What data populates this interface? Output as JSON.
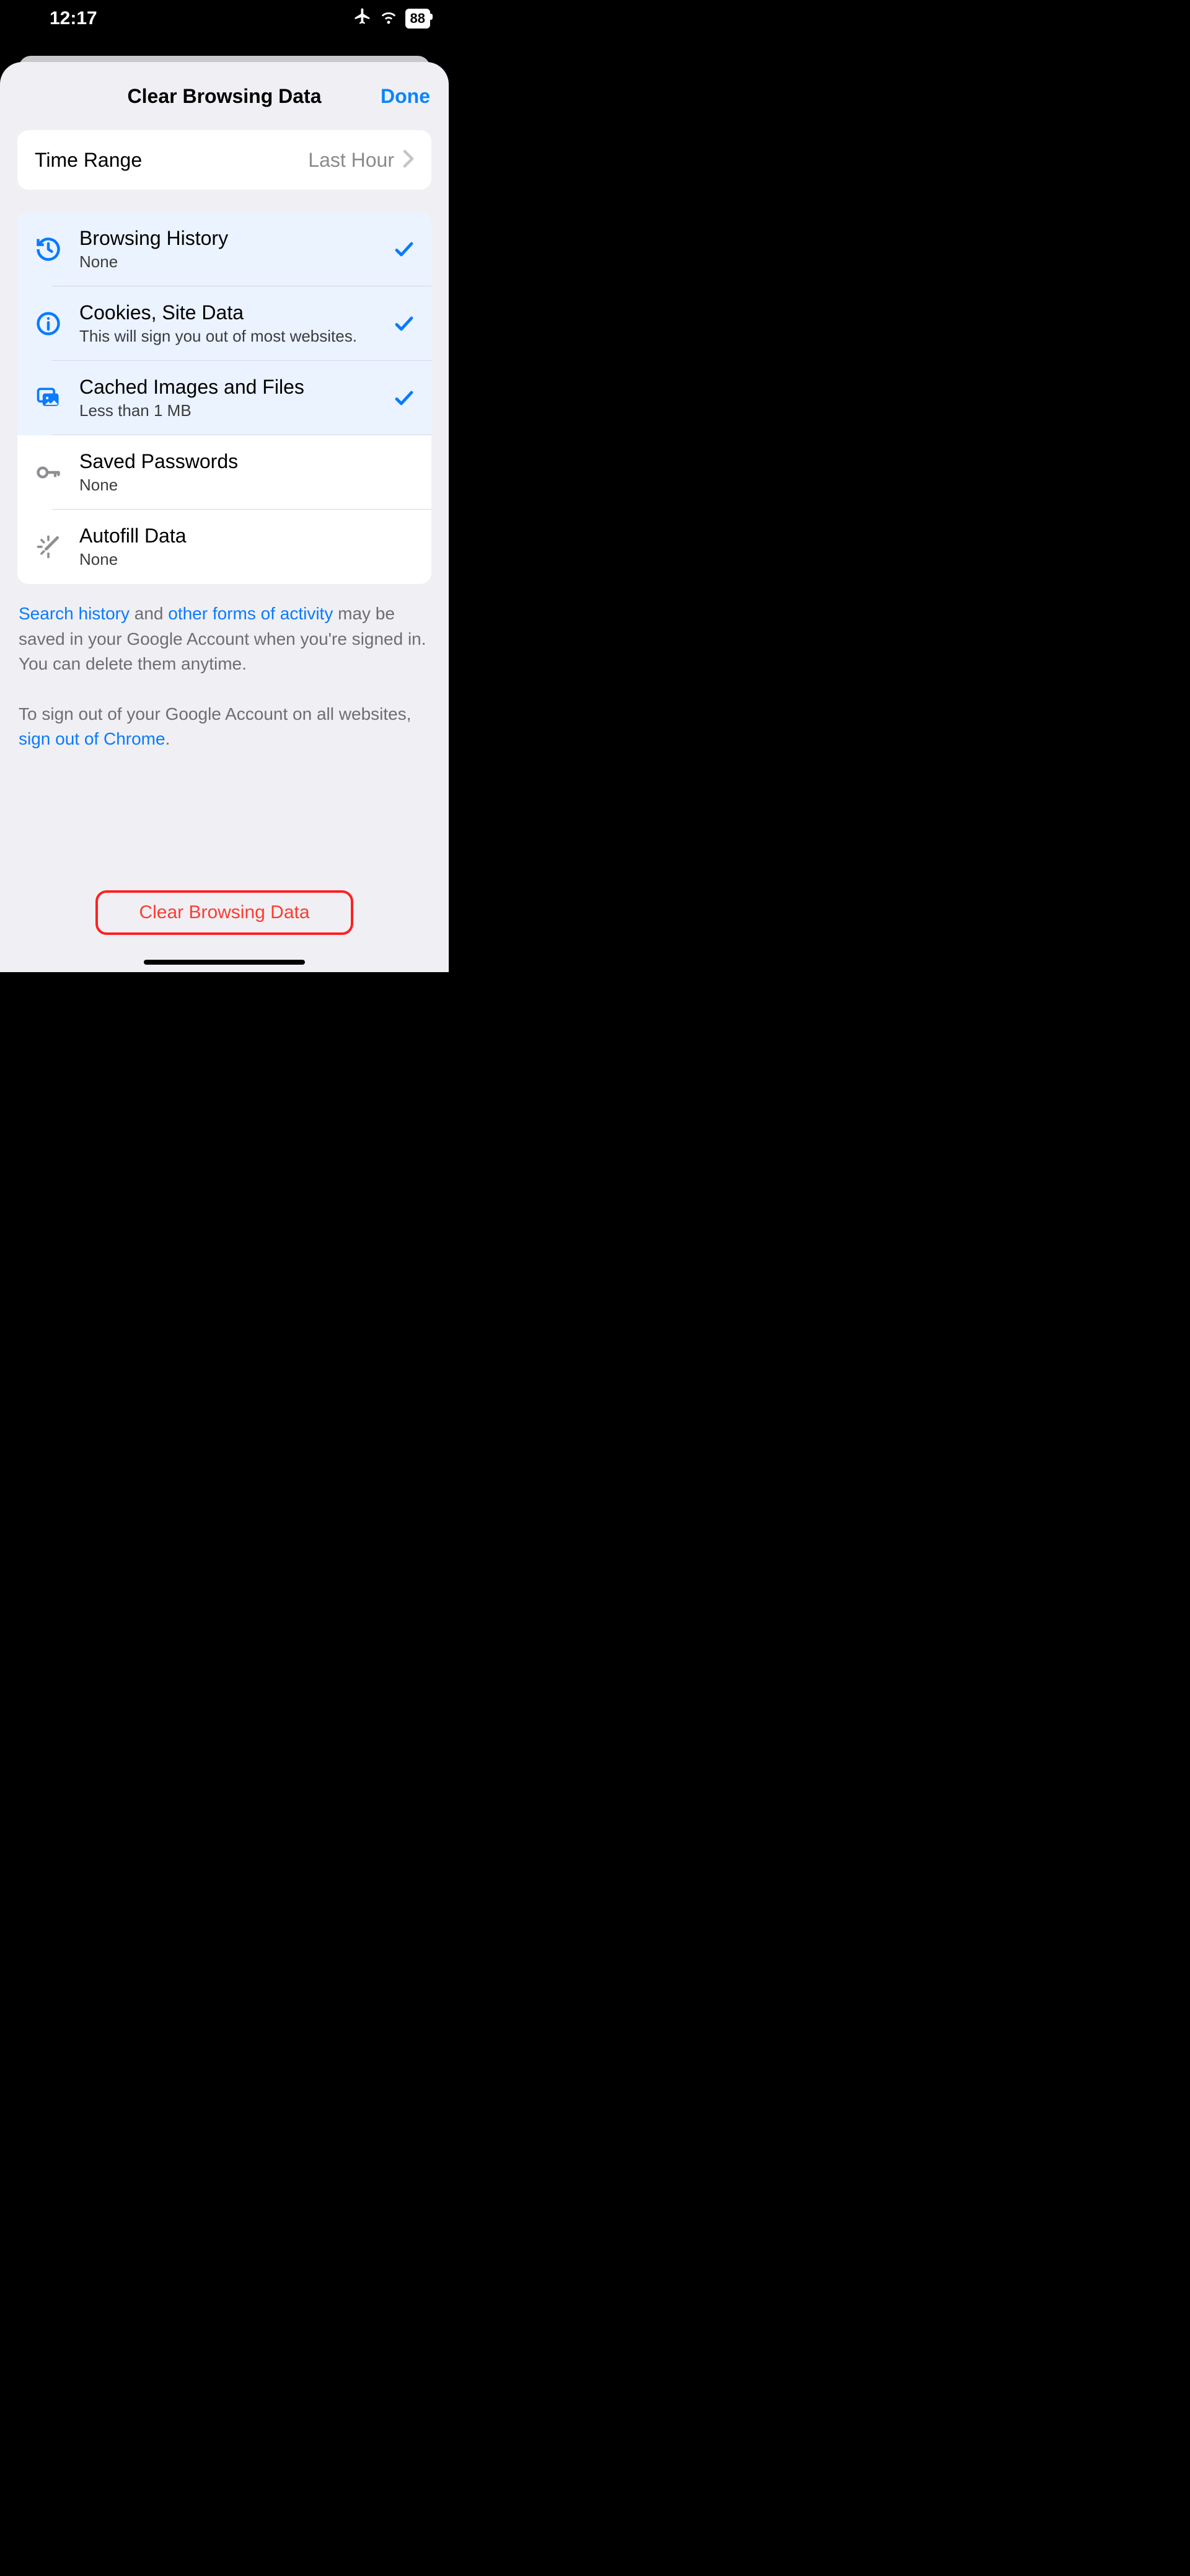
{
  "statusbar": {
    "time": "12:17",
    "battery": "88"
  },
  "sheet": {
    "title": "Clear Browsing Data",
    "done": "Done"
  },
  "time_range": {
    "label": "Time Range",
    "value": "Last Hour"
  },
  "items": [
    {
      "title": "Browsing History",
      "sub": "None",
      "selected": true
    },
    {
      "title": "Cookies, Site Data",
      "sub": "This will sign you out of most websites.",
      "selected": true
    },
    {
      "title": "Cached Images and Files",
      "sub": "Less than 1 MB",
      "selected": true
    },
    {
      "title": "Saved Passwords",
      "sub": "None",
      "selected": false
    },
    {
      "title": "Autofill Data",
      "sub": "None",
      "selected": false
    }
  ],
  "footer": {
    "link1": "Search history",
    "mid1": " and ",
    "link2": "other forms of activity",
    "rest1": " may be saved in your Google Account when you're signed in. You can delete them anytime.",
    "pre2": "To sign out of your Google Account on all websites, ",
    "link3": "sign out of Chrome",
    "post2": "."
  },
  "clear_button": "Clear Browsing Data"
}
